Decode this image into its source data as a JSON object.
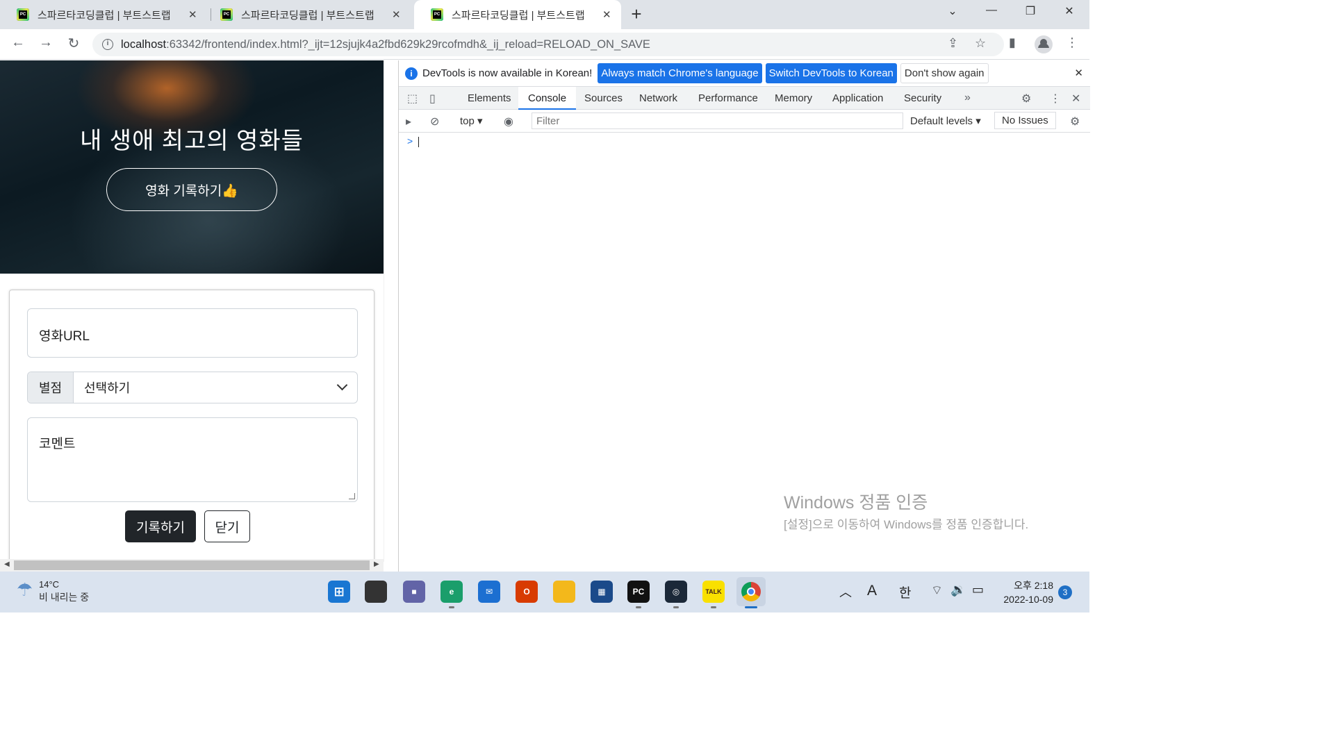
{
  "browser": {
    "tabs": [
      {
        "title": "스파르타코딩클럽 | 부트스트랩",
        "active": false
      },
      {
        "title": "스파르타코딩클럽 | 부트스트랩",
        "active": false
      },
      {
        "title": "스파르타코딩클럽 | 부트스트랩",
        "active": true
      }
    ],
    "new_tab": "+",
    "url_host": "localhost",
    "url_rest": ":63342/frontend/index.html?_ijt=12sjujk4a2fbd629k29rcofmdh&_ij_reload=RELOAD_ON_SAVE"
  },
  "page": {
    "hero_title": "내 생애 최고의 영화들",
    "hero_button": "영화 기록하기👍",
    "url_placeholder": "영화URL",
    "star_label": "별점",
    "star_selected": "선택하기",
    "comment_placeholder": "코멘트",
    "save_button": "기록하기",
    "close_button": "닫기"
  },
  "devtools": {
    "infobar_text": "DevTools is now available in Korean!",
    "btn_match": "Always match Chrome's language",
    "btn_switch": "Switch DevTools to Korean",
    "btn_dont_show": "Don't show again",
    "tabs": [
      "Elements",
      "Console",
      "Sources",
      "Network",
      "Performance",
      "Memory",
      "Application",
      "Security"
    ],
    "active_tab": "Console",
    "context": "top",
    "filter_placeholder": "Filter",
    "levels": "Default levels",
    "issues": "No Issues",
    "prompt": ">"
  },
  "watermark": {
    "title": "Windows 정품 인증",
    "text": "[설정]으로 이동하여 Windows를 정품 인증합니다."
  },
  "taskbar": {
    "temp": "14°C",
    "weather": "비 내리는 중",
    "ime_a": "A",
    "ime_han": "한",
    "time": "오후 2:18",
    "date": "2022-10-09",
    "notifications": "3"
  },
  "colors": {
    "accent": "#1a73e8",
    "dark_button": "#212529",
    "taskbar": "#dae3ef"
  }
}
